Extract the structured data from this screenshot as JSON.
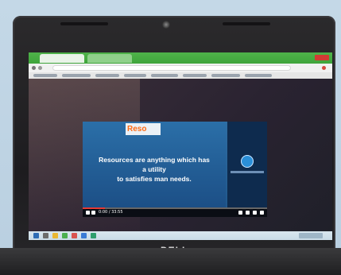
{
  "photo": {
    "subject": "Dell laptop showing an online class video in a web browser"
  },
  "browser": {
    "tabs_count": 2
  },
  "video": {
    "logo_text": "Reso",
    "slide_lines": [
      "Resources are anything which has",
      "a utility",
      "to satisfies man needs."
    ],
    "progress_fraction": 0.12,
    "time_text": "0:00 / 33:55"
  },
  "laptop": {
    "brand": "DELL"
  },
  "colors": {
    "tab_green": "#4fb34a",
    "slide_blue": "#2b6fa8",
    "logo_orange": "#ff6a13",
    "progress_red": "#e63a34"
  }
}
